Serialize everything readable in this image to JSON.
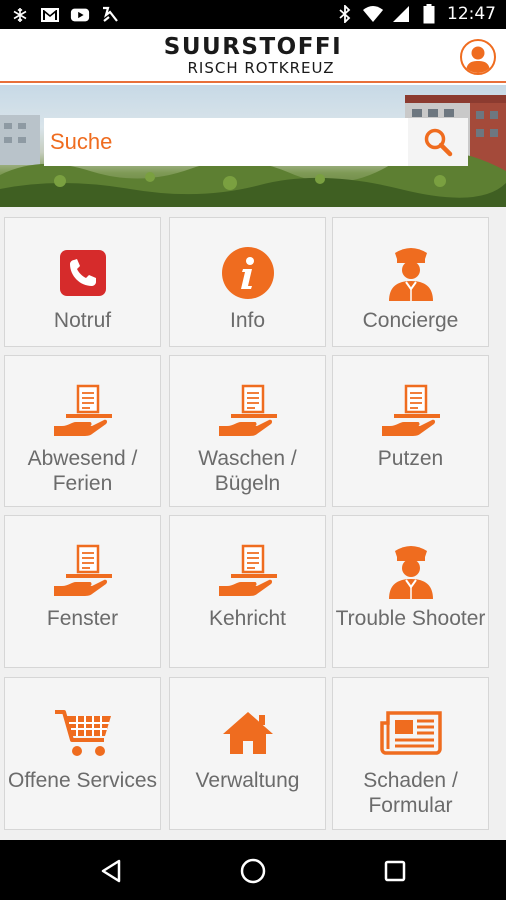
{
  "status_bar": {
    "time": "12:47",
    "left_icons": [
      "snowflake-icon",
      "gmail-icon",
      "youtube-icon",
      "download-check-icon"
    ],
    "right_icons": [
      "bluetooth-icon",
      "wifi-icon",
      "signal-icon",
      "battery-icon"
    ]
  },
  "header": {
    "title": "SUURSTOFFI",
    "subtitle": "RISCH ROTKREUZ",
    "accent_color": "#ef6c1f"
  },
  "search": {
    "placeholder": "Suche"
  },
  "tiles": [
    {
      "label": "Notruf",
      "icon": "phone-icon"
    },
    {
      "label": "Info",
      "icon": "info-icon"
    },
    {
      "label": "Concierge",
      "icon": "concierge-icon"
    },
    {
      "label": "Abwesend / Ferien",
      "icon": "service-tray-icon"
    },
    {
      "label": "Waschen / Bügeln",
      "icon": "service-tray-icon"
    },
    {
      "label": "Putzen",
      "icon": "service-tray-icon"
    },
    {
      "label": "Fenster",
      "icon": "service-tray-icon"
    },
    {
      "label": "Kehricht",
      "icon": "service-tray-icon"
    },
    {
      "label": "Trouble Shooter",
      "icon": "concierge-icon"
    },
    {
      "label": "Offene Services",
      "icon": "cart-icon"
    },
    {
      "label": "Verwaltung",
      "icon": "home-icon"
    },
    {
      "label": "Schaden / Formular",
      "icon": "newspaper-icon"
    }
  ],
  "nav": [
    "back-icon",
    "home-circle-icon",
    "recents-icon"
  ]
}
